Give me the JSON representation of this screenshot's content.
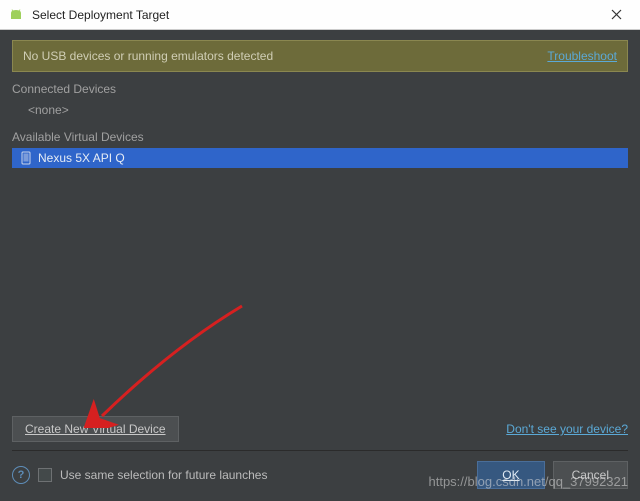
{
  "titlebar": {
    "title": "Select Deployment Target"
  },
  "warning": {
    "message": "No USB devices or running emulators detected",
    "troubleshoot": "Troubleshoot"
  },
  "sections": {
    "connected_label": "Connected Devices",
    "connected_none": "<none>",
    "available_label": "Available Virtual Devices"
  },
  "devices": {
    "virtual": [
      {
        "name": "Nexus 5X API Q"
      }
    ]
  },
  "actions": {
    "create_device": "Create New Virtual Device",
    "dont_see": "Don't see your device?",
    "use_same": "Use same selection for future launches",
    "ok": "OK",
    "cancel": "Cancel"
  },
  "watermark": "https://blog.csdn.net/qq_37992321"
}
